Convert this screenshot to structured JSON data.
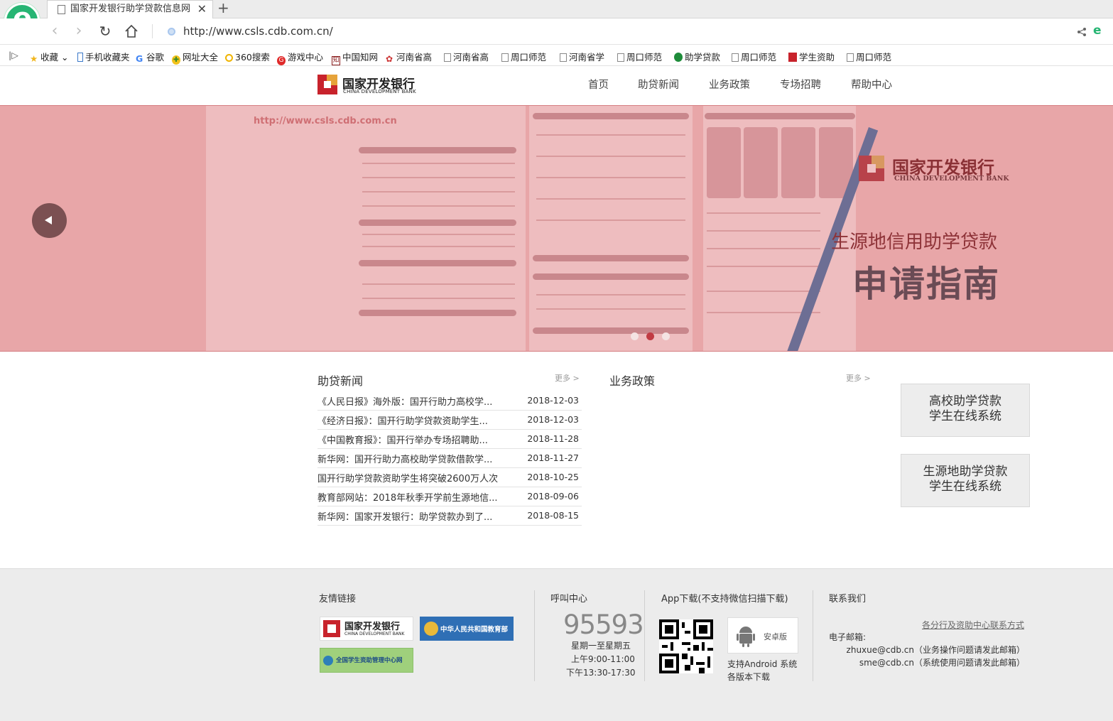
{
  "browser": {
    "tab_title": "国家开发银行助学贷款信息网",
    "url": "http://www.csls.cdb.com.cn/",
    "bookmarks": [
      "收藏",
      "手机收藏夹",
      "谷歌",
      "网址大全",
      "360搜索",
      "游戏中心",
      "中国知网",
      "河南省高",
      "河南省高",
      "周口师范",
      "河南省学",
      "周口师范",
      "助学贷款",
      "周口师范",
      "学生资助",
      "周口师范"
    ]
  },
  "site": {
    "logo_cn": "国家开发银行",
    "logo_en": "CHINA DEVELOPMENT BANK",
    "nav": [
      "首页",
      "助贷新闻",
      "业务政策",
      "专场招聘",
      "帮助中心"
    ]
  },
  "banner": {
    "url_text": "http://www.csls.cdb.com.cn",
    "logo_cn": "国家开发银行",
    "logo_en": "CHINA DEVELOPMENT BANK",
    "subtitle": "生源地信用助学贷款",
    "title": "申请指南",
    "active_dot": 1
  },
  "news": {
    "title": "助贷新闻",
    "more": "更多 >",
    "items": [
      {
        "title": "《人民日报》海外版：国开行助力高校学...",
        "date": "2018-12-03"
      },
      {
        "title": "《经济日报》：国开行助学贷款资助学生...",
        "date": "2018-12-03"
      },
      {
        "title": "《中国教育报》：国开行举办专场招聘助...",
        "date": "2018-11-28"
      },
      {
        "title": "新华网：国开行助力高校助学贷款借款学...",
        "date": "2018-11-27"
      },
      {
        "title": "国开行助学贷款资助学生将突破2600万人次",
        "date": "2018-10-25"
      },
      {
        "title": "教育部网站：2018年秋季开学前生源地信...",
        "date": "2018-09-06"
      },
      {
        "title": "新华网：国家开发银行：助学贷款办到了...",
        "date": "2018-08-15"
      }
    ]
  },
  "policy": {
    "title": "业务政策",
    "more": "更多 >"
  },
  "systems": [
    {
      "line1": "高校助学贷款",
      "line2": "学生在线系统"
    },
    {
      "line1": "生源地助学贷款",
      "line2": "学生在线系统"
    }
  ],
  "footer": {
    "links_title": "友情链接",
    "link_cdb_cn": "国家开发银行",
    "link_cdb_en": "CHINA DEVELOPMENT BANK",
    "link_moe": "中华人民共和国教育部",
    "link_xszz": "全国学生资助管理中心网",
    "call_title": "呼叫中心",
    "phone": "95593",
    "hours1": "星期一至星期五",
    "hours2": "上午9:00-11:00",
    "hours3": "下午13:30-17:30",
    "app_title": "App下载(不支持微信扫描下载)",
    "android_btn": "安卓版",
    "android_note1": "支持Android 系统",
    "android_note2": "各版本下载",
    "contact_title": "联系我们",
    "branch_link": "各分行及资助中心联系方式",
    "email_label": "电子邮箱:",
    "email1": "zhuxue@cdb.cn（业务操作问题请发此邮箱）",
    "email2": "sme@cdb.cn（系统使用问题请发此邮箱）"
  }
}
